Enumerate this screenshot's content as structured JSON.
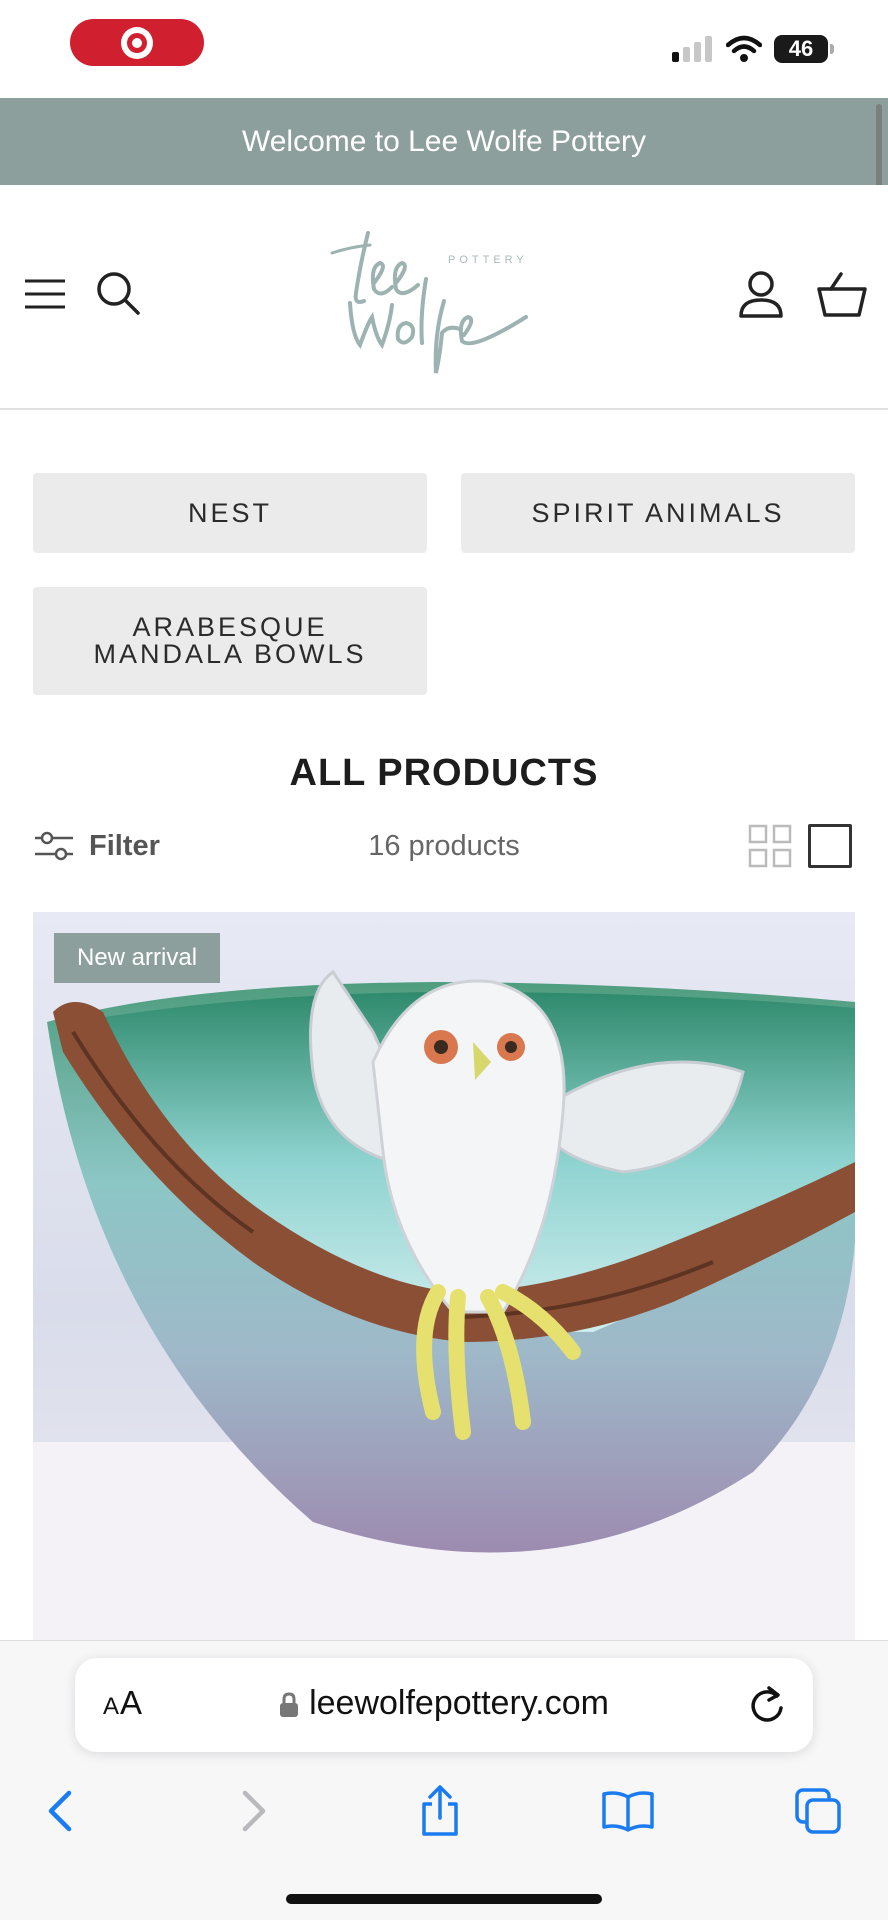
{
  "status_bar": {
    "battery_level": "46",
    "signal_bars_active": 1,
    "signal_bars_total": 4,
    "recording_indicator_color": "#d0202f"
  },
  "announcement": {
    "text": "Welcome to Lee Wolfe Pottery",
    "background_color": "#8d9f9d"
  },
  "header": {
    "logo": {
      "script_line_1": "Lee",
      "script_line_2": "Wolfe",
      "tagline": "POTTERY"
    },
    "icons": [
      "menu-icon",
      "search-icon",
      "account-icon",
      "cart-icon"
    ]
  },
  "collections": [
    {
      "label": "NEST"
    },
    {
      "label": "SPIRIT ANIMALS"
    },
    {
      "label": "ARABESQUE\nMANDALA BOWLS"
    }
  ],
  "page": {
    "title": "ALL PRODUCTS",
    "filter_label": "Filter",
    "product_count": "16 products",
    "view_modes": [
      "grid-view-icon",
      "single-view-icon"
    ],
    "active_view": "single"
  },
  "products": [
    {
      "badge": "New arrival",
      "image_description": "ceramic owl with spread wings perched on a branch-rimmed turquoise bowl"
    }
  ],
  "browser": {
    "text_size_label_small": "A",
    "text_size_label_large": "A",
    "url": "leewolfepottery.com",
    "accent_color": "#1a7cf0"
  }
}
